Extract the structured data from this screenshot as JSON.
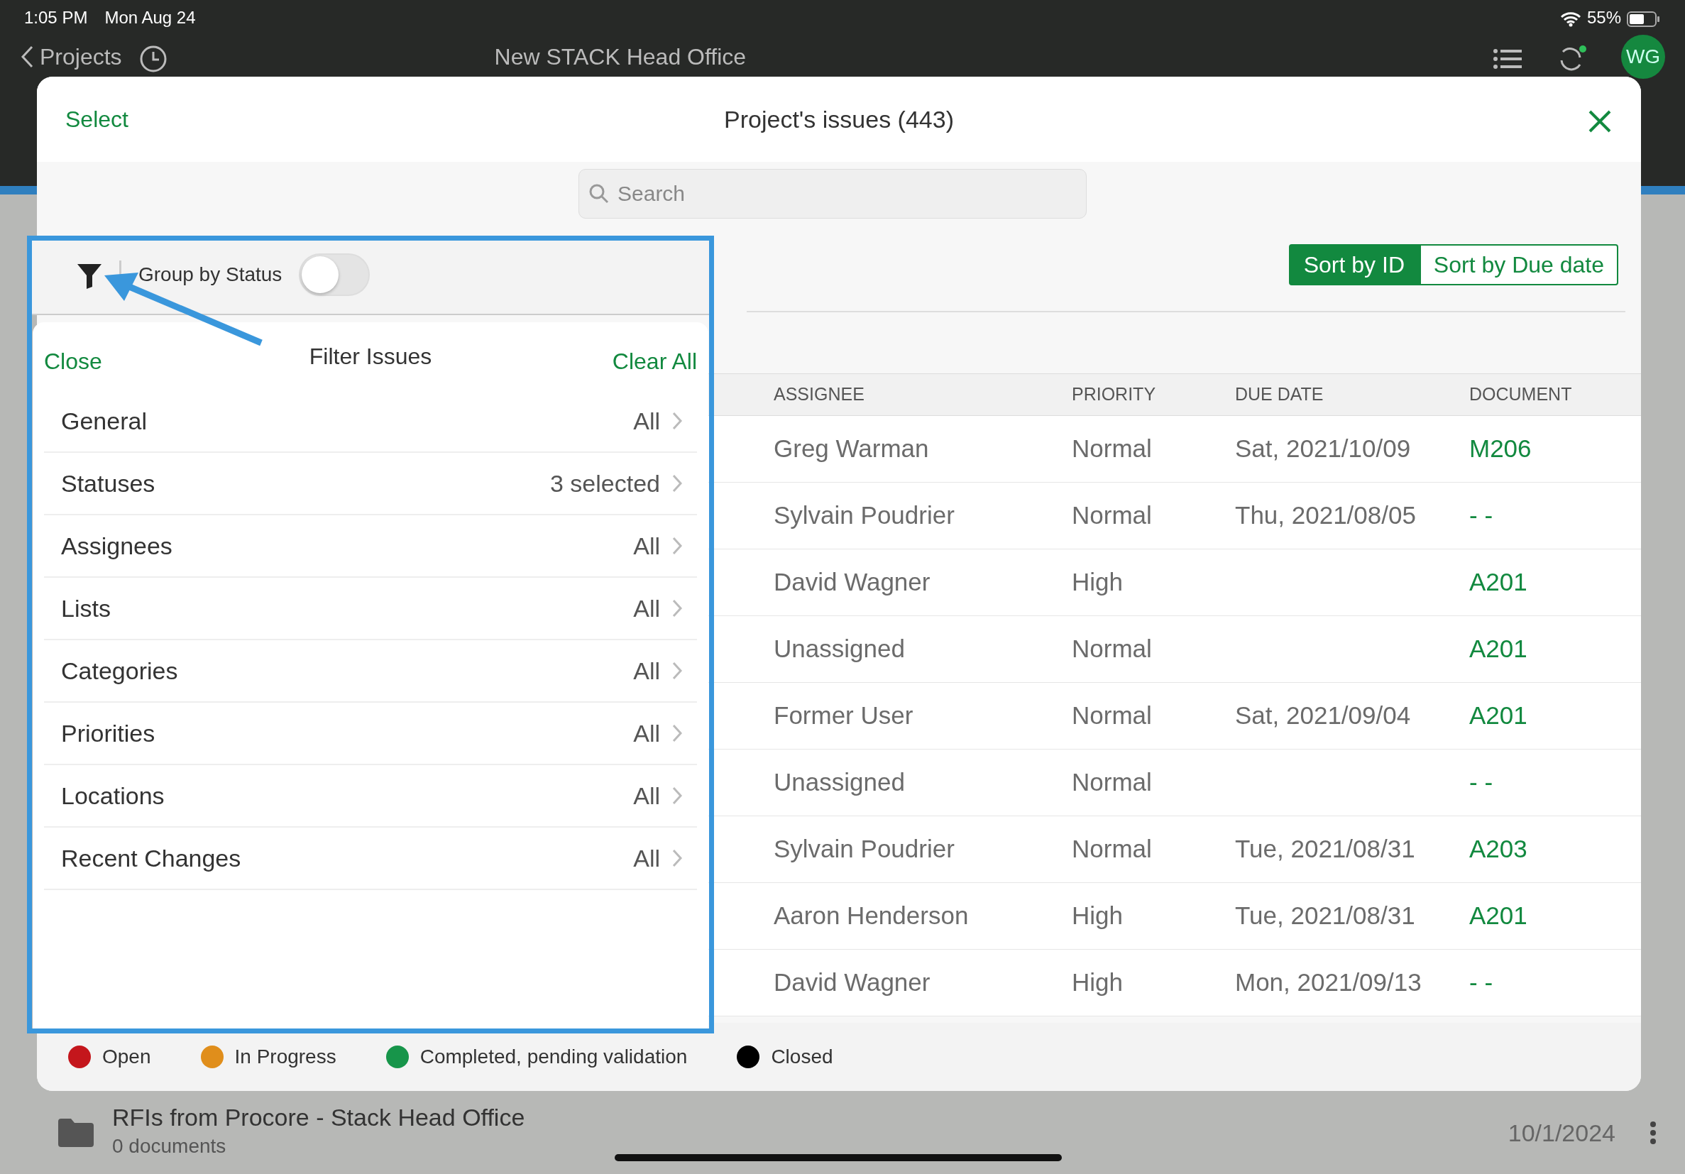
{
  "status_bar": {
    "time": "1:05 PM",
    "date": "Mon Aug 24",
    "battery": "55%"
  },
  "nav": {
    "back": "Projects",
    "title": "New STACK Head Office",
    "avatar": "WG"
  },
  "modal": {
    "select": "Select",
    "title": "Project's issues (443)",
    "search": {
      "placeholder": "Search"
    },
    "sort_options": [
      {
        "label": "Sort by ID",
        "selected": true
      },
      {
        "label": "Sort by Due date",
        "selected": false
      }
    ],
    "table": {
      "columns": [
        "ASSIGNEE",
        "PRIORITY",
        "DUE DATE",
        "DOCUMENT"
      ],
      "rows": [
        {
          "assignee": "Greg Warman",
          "priority": "Normal",
          "due_date": "Sat, 2021/10/09",
          "document": "M206"
        },
        {
          "assignee": "Sylvain Poudrier",
          "priority": "Normal",
          "due_date": "Thu, 2021/08/05",
          "document": "- -"
        },
        {
          "assignee": "David Wagner",
          "priority": "High",
          "document": "A201"
        },
        {
          "assignee": "Unassigned",
          "priority": "Normal",
          "document": "A201"
        },
        {
          "assignee": "Former User",
          "priority": "Normal",
          "due_date": "Sat, 2021/09/04",
          "document": "A201"
        },
        {
          "assignee": "Unassigned",
          "priority": "Normal",
          "document": "- -"
        },
        {
          "assignee": "Sylvain Poudrier",
          "priority": "Normal",
          "due_date": "Tue, 2021/08/31",
          "document": "A203"
        },
        {
          "assignee": "Aaron Henderson",
          "priority": "High",
          "due_date": "Tue, 2021/08/31",
          "document": "A201"
        },
        {
          "assignee": "David Wagner",
          "priority": "High",
          "due_date": "Mon, 2021/09/13",
          "document": "- -"
        }
      ]
    },
    "legend": [
      {
        "label": "Open",
        "color": "#c4161c"
      },
      {
        "label": "In Progress",
        "color": "#e08e1b"
      },
      {
        "label": "Completed, pending validation",
        "color": "#17954a"
      },
      {
        "label": "Closed",
        "color": "#000000"
      }
    ]
  },
  "filter_popover": {
    "group_by_status": {
      "label": "Group by Status",
      "on": false
    },
    "close": "Close",
    "title": "Filter Issues",
    "clear_all": "Clear All",
    "items": [
      {
        "label": "General",
        "value": "All"
      },
      {
        "label": "Statuses",
        "value": "3 selected"
      },
      {
        "label": "Assignees",
        "value": "All"
      },
      {
        "label": "Lists",
        "value": "All"
      },
      {
        "label": "Categories",
        "value": "All"
      },
      {
        "label": "Priorities",
        "value": "All"
      },
      {
        "label": "Locations",
        "value": "All"
      },
      {
        "label": "Recent Changes",
        "value": "All"
      }
    ]
  },
  "background_row": {
    "title": "RFIs from Procore - Stack Head Office",
    "subtitle": "0 documents",
    "date": "10/1/2024"
  }
}
